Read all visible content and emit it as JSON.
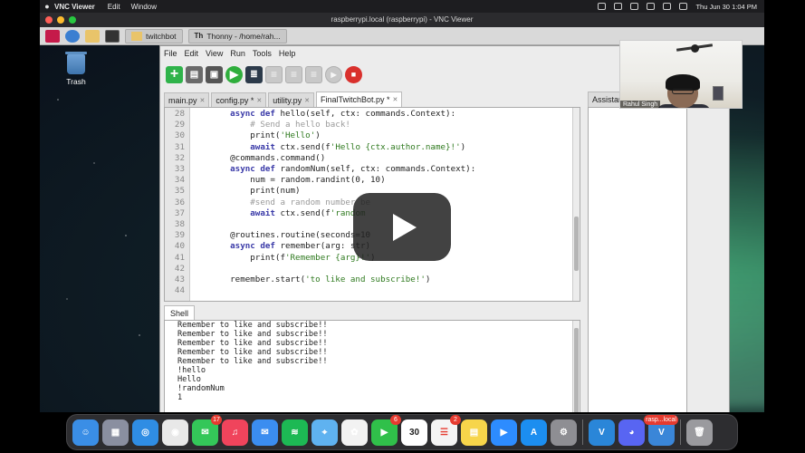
{
  "mac_menubar": {
    "app": "VNC Viewer",
    "menus": [
      "Edit",
      "Window"
    ],
    "datetime": "Thu Jun 30  1:04 PM"
  },
  "vnc": {
    "title": "raspberrypi.local (raspberrypi) - VNC Viewer"
  },
  "rpi_taskbar": {
    "tasks": [
      "twitchbot",
      "Thonny  -  /home/rah..."
    ]
  },
  "desktop": {
    "trash_label": "Trash"
  },
  "thonny": {
    "menus": [
      "File",
      "Edit",
      "View",
      "Run",
      "Tools",
      "Help"
    ],
    "tabs": [
      {
        "label": "main.py",
        "active": false
      },
      {
        "label": "config.py *",
        "active": false
      },
      {
        "label": "utility.py",
        "active": false
      },
      {
        "label": "FinalTwitchBot.py *",
        "active": true
      }
    ],
    "code_lines": [
      {
        "n": "28",
        "text": "    async def hello(self, ctx: commands.Context):"
      },
      {
        "n": "29",
        "text": "        # Send a hello back!"
      },
      {
        "n": "30",
        "text": "        print('Hello')"
      },
      {
        "n": "31",
        "text": "        await ctx.send(f'Hello {ctx.author.name}!')"
      },
      {
        "n": "32",
        "text": "    @commands.command()"
      },
      {
        "n": "33",
        "text": "    async def randomNum(self, ctx: commands.Context):"
      },
      {
        "n": "34",
        "text": "        num = random.randint(0, 10)"
      },
      {
        "n": "35",
        "text": "        print(num)"
      },
      {
        "n": "36",
        "text": "        #send a random number be"
      },
      {
        "n": "37",
        "text": "        await ctx.send(f'random"
      },
      {
        "n": "38",
        "text": ""
      },
      {
        "n": "39",
        "text": "    @routines.routine(seconds=10"
      },
      {
        "n": "40",
        "text": "    async def remember(arg: str)"
      },
      {
        "n": "41",
        "text": "        print(f'Remember {arg}!')"
      },
      {
        "n": "42",
        "text": ""
      },
      {
        "n": "43",
        "text": "    remember.start('to like and subscribe!')"
      },
      {
        "n": "44",
        "text": ""
      }
    ],
    "shell_tab": "Shell",
    "shell_lines": [
      "Remember to like and subscribe!!",
      "Remember to like and subscribe!!",
      "Remember to like and subscribe!!",
      "Remember to like and subscribe!!",
      "Remember to like and subscribe!!",
      "!hello",
      "Hello",
      "!randomNum",
      "1"
    ],
    "assistant_tab": "Assistant"
  },
  "webcam": {
    "name": "Rahul Singh"
  },
  "dock": {
    "items": [
      {
        "icon": "finder-icon",
        "color": "#3a8ee6",
        "glyph": "☺"
      },
      {
        "icon": "launchpad-icon",
        "color": "#8a8fa0",
        "glyph": "▦"
      },
      {
        "icon": "safari-icon",
        "color": "#2f8de4",
        "glyph": "◎"
      },
      {
        "icon": "chrome-icon",
        "color": "#e8e8e8",
        "glyph": "◉"
      },
      {
        "icon": "messages-icon",
        "color": "#34c759",
        "glyph": "✉",
        "badge": "17"
      },
      {
        "icon": "music-icon",
        "color": "#f0445c",
        "glyph": "♫"
      },
      {
        "icon": "mail-icon",
        "color": "#3b8df0",
        "glyph": "✉"
      },
      {
        "icon": "spotify-icon",
        "color": "#1db954",
        "glyph": "≋"
      },
      {
        "icon": "maps-icon",
        "color": "#5fb2f0",
        "glyph": "⌖"
      },
      {
        "icon": "photos-icon",
        "color": "#f2f2f2",
        "glyph": "✿"
      },
      {
        "icon": "facetime-icon",
        "color": "#30c04a",
        "glyph": "▶",
        "badge": "6"
      },
      {
        "icon": "calendar-icon",
        "color": "#ffffff",
        "glyph": "30",
        "text_color": "#222"
      },
      {
        "icon": "reminders-icon",
        "color": "#f4f4f4",
        "glyph": "☰",
        "text_color": "#e63b30",
        "badge": "2"
      },
      {
        "icon": "notes-icon",
        "color": "#f7d54a",
        "glyph": "▤"
      },
      {
        "icon": "zoom-icon",
        "color": "#2d8cff",
        "glyph": "▶"
      },
      {
        "icon": "app-store-icon",
        "color": "#1c8ef0",
        "glyph": "A"
      },
      {
        "icon": "system-preferences-icon",
        "color": "#8e8e93",
        "glyph": "⚙"
      },
      {
        "sep": true
      },
      {
        "icon": "vscode-icon",
        "color": "#2a86d8",
        "glyph": "V"
      },
      {
        "icon": "discord-icon",
        "color": "#5865f2",
        "glyph": "◕"
      },
      {
        "icon": "vnc-viewer-icon",
        "color": "#3a86d8",
        "glyph": "V",
        "badge": "rasp...local"
      },
      {
        "sep": true
      },
      {
        "icon": "trash-icon",
        "color": "#9a9a9e",
        "glyph": "🗑"
      }
    ]
  }
}
